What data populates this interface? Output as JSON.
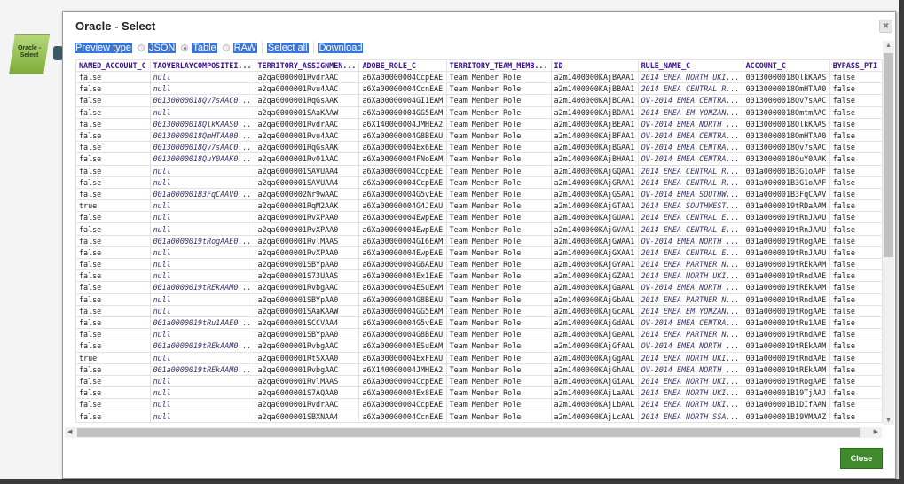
{
  "node": {
    "label": "Oracle - Select"
  },
  "dialog": {
    "title": "Oracle - Select",
    "toolbar": {
      "preview_type_label": "Preview type",
      "options": [
        {
          "label": "JSON",
          "selected": false
        },
        {
          "label": "Table",
          "selected": true
        },
        {
          "label": "RAW",
          "selected": false
        }
      ],
      "select_all_label": "Select all",
      "download_label": "Download"
    },
    "close_label": "Close",
    "accent_color": "#3f8a2a",
    "table": {
      "columns": [
        "NAMED_ACCOUNT_C",
        "TAOVERLAYCOMPOSITEI...",
        "TERRITORY_ASSIGNMEN...",
        "ADOBE_ROLE_C",
        "TERRITORY_TEAM_MEMB...",
        "ID",
        "RULE_NAME_C",
        "ACCOUNT_C",
        "BYPASS_PTI"
      ],
      "rows": [
        [
          "false",
          "null",
          "a2qa0000001RvdrAAC",
          "a6Xa00000004CcpEAE",
          "Team Member Role",
          "a2m1400000KAjBAAA1",
          "2014 EMEA NORTH UKI...",
          "00130000018QlkKAAS",
          "false"
        ],
        [
          "false",
          "null",
          "a2qa0000001Rvu4AAC",
          "a6Xa00000004CcnEAE",
          "Team Member Role",
          "a2m1400000KAjBBAA1",
          "2014 EMEA CENTRAL R...",
          "00130000018QmHTAA0",
          "false"
        ],
        [
          "false",
          "00130000018Qv7sAAC0...",
          "a2qa0000001RqGsAAK",
          "a6Xa00000004GI1EAM",
          "Team Member Role",
          "a2m1400000KAjBCAA1",
          "OV-2014 EMEA CENTRA...",
          "00130000018Qv7sAAC",
          "false"
        ],
        [
          "false",
          "null",
          "a2qa0000001SAaKAAW",
          "a6Xa00000004GG5EAM",
          "Team Member Role",
          "a2m1400000KAjBDAA1",
          "2014 EMEA EM YONZAN...",
          "00130000018QmtmAAC",
          "false"
        ],
        [
          "false",
          "00130000018QlkKAAS0...",
          "a2qa0000001RvdrAAC",
          "a6X140000004JMHEA2",
          "Team Member Role",
          "a2m1400000KAjBEAA1",
          "OV-2014 EMEA NORTH ...",
          "00130000018QlkKAAS",
          "false"
        ],
        [
          "false",
          "00130000018QmHTAA00...",
          "a2qa0000001Rvu4AAC",
          "a6Xa00000004G8BEAU",
          "Team Member Role",
          "a2m1400000KAjBFAA1",
          "OV-2014 EMEA CENTRA...",
          "00130000018QmHTAA0",
          "false"
        ],
        [
          "false",
          "00130000018Qv7sAAC0...",
          "a2qa0000001RqGsAAK",
          "a6Xa00000004Ex6EAE",
          "Team Member Role",
          "a2m1400000KAjBGAA1",
          "OV-2014 EMEA CENTRA...",
          "00130000018Qv7sAAC",
          "false"
        ],
        [
          "false",
          "00130000018QuY0AAK0...",
          "a2qa0000001Rv01AAC",
          "a6Xa00000004FNoEAM",
          "Team Member Role",
          "a2m1400000KAjBHAA1",
          "OV-2014 EMEA CENTRA...",
          "00130000018QuY0AAK",
          "false"
        ],
        [
          "false",
          "null",
          "a2qa0000001SAVUAA4",
          "a6Xa00000004CcpEAE",
          "Team Member Role",
          "a2m1400000KAjGQAA1",
          "2014 EMEA CENTRAL R...",
          "001a000001B3G1oAAF",
          "false"
        ],
        [
          "false",
          "null",
          "a2qa0000001SAVUAA4",
          "a6Xa00000004CcpEAE",
          "Team Member Role",
          "a2m1400000KAjGRAA1",
          "2014 EMEA CENTRAL R...",
          "001a000001B3G1oAAF",
          "false"
        ],
        [
          "false",
          "001a000001B3FqCAAV0...",
          "a2qa0000002Nr9wAAC",
          "a6Xa00000004G5vEAE",
          "Team Member Role",
          "a2m1400000KAjGSAA1",
          "OV-2014 EMEA SOUTHW...",
          "001a000001B3FqCAAV",
          "false"
        ],
        [
          "true",
          "null",
          "a2qa0000001RqM2AAK",
          "a6Xa00000004G4JEAU",
          "Team Member Role",
          "a2m1400000KAjGTAA1",
          "2014 EMEA SOUTHWEST...",
          "001a0000019tRDaAAM",
          "false"
        ],
        [
          "false",
          "null",
          "a2qa0000001RvXPAA0",
          "a6Xa00000004EwpEAE",
          "Team Member Role",
          "a2m1400000KAjGUAA1",
          "2014 EMEA CENTRAL E...",
          "001a0000019tRnJAAU",
          "false"
        ],
        [
          "false",
          "null",
          "a2qa0000001RvXPAA0",
          "a6Xa00000004EwpEAE",
          "Team Member Role",
          "a2m1400000KAjGVAA1",
          "2014 EMEA CENTRAL E...",
          "001a0000019tRnJAAU",
          "false"
        ],
        [
          "false",
          "001a0000019tRogAAE0...",
          "a2qa0000001RvlMAAS",
          "a6Xa00000004GI6EAM",
          "Team Member Role",
          "a2m1400000KAjGWAA1",
          "OV-2014 EMEA NORTH ...",
          "001a0000019tRogAAE",
          "false"
        ],
        [
          "false",
          "null",
          "a2qa0000001RvXPAA0",
          "a6Xa00000004EwpEAE",
          "Team Member Role",
          "a2m1400000KAjGXAA1",
          "2014 EMEA CENTRAL E...",
          "001a0000019tRnJAAU",
          "false"
        ],
        [
          "false",
          "null",
          "a2qa0000001SBYpAA0",
          "a6Xa00000004G6AEAU",
          "Team Member Role",
          "a2m1400000KAjGYAA1",
          "2014 EMEA PARTNER N...",
          "001a0000019tREkAAM",
          "false"
        ],
        [
          "false",
          "null",
          "a2qa0000001S73UAAS",
          "a6Xa00000004Ex1EAE",
          "Team Member Role",
          "a2m1400000KAjGZAA1",
          "2014 EMEA NORTH UKI...",
          "001a0000019tRndAAE",
          "false"
        ],
        [
          "false",
          "001a0000019tREkAAM0...",
          "a2qa0000001RvbgAAC",
          "a6Xa00000004ESuEAM",
          "Team Member Role",
          "a2m1400000KAjGaAAL",
          "OV-2014 EMEA NORTH ...",
          "001a0000019tREkAAM",
          "false"
        ],
        [
          "false",
          "null",
          "a2qa0000001SBYpAA0",
          "a6Xa00000004G8BEAU",
          "Team Member Role",
          "a2m1400000KAjGbAAL",
          "2014 EMEA PARTNER N...",
          "001a0000019tRndAAE",
          "false"
        ],
        [
          "false",
          "null",
          "a2qa0000001SAaKAAW",
          "a6Xa00000004GG5EAM",
          "Team Member Role",
          "a2m1400000KAjGcAAL",
          "2014 EMEA EM YONZAN...",
          "001a0000019tRogAAE",
          "false"
        ],
        [
          "false",
          "001a0000019tRu1AAE0...",
          "a2qa0000001SCCVAA4",
          "a6Xa00000004G5vEAE",
          "Team Member Role",
          "a2m1400000KAjGdAAL",
          "OV-2014 EMEA CENTRA...",
          "001a0000019tRu1AAE",
          "false"
        ],
        [
          "false",
          "null",
          "a2qa0000001SBYpAA0",
          "a6Xa00000004G8BEAU",
          "Team Member Role",
          "a2m1400000KAjGeAAL",
          "2014 EMEA PARTNER N...",
          "001a0000019tRndAAE",
          "false"
        ],
        [
          "false",
          "001a0000019tREkAAM0...",
          "a2qa0000001RvbgAAC",
          "a6Xa00000004ESuEAM",
          "Team Member Role",
          "a2m1400000KAjGfAAL",
          "OV-2014 EMEA NORTH ...",
          "001a0000019tREkAAM",
          "false"
        ],
        [
          "true",
          "null",
          "a2qa0000001RtSXAA0",
          "a6Xa00000004ExFEAU",
          "Team Member Role",
          "a2m1400000KAjGgAAL",
          "2014 EMEA NORTH UKI...",
          "001a0000019tRndAAE",
          "false"
        ],
        [
          "false",
          "001a0000019tREkAAM0...",
          "a2qa0000001RvbgAAC",
          "a6X140000004JMHEA2",
          "Team Member Role",
          "a2m1400000KAjGhAAL",
          "OV-2014 EMEA NORTH ...",
          "001a0000019tREkAAM",
          "false"
        ],
        [
          "false",
          "null",
          "a2qa0000001RvlMAAS",
          "a6Xa00000004CcpEAE",
          "Team Member Role",
          "a2m1400000KAjGiAAL",
          "2014 EMEA NORTH UKI...",
          "001a0000019tRogAAE",
          "false"
        ],
        [
          "false",
          "null",
          "a2qa0000001S7AQAA0",
          "a6Xa00000004Ex8EAE",
          "Team Member Role",
          "a2m1400000KAjLaAAL",
          "2014 EMEA NORTH UKI...",
          "001a000001B19TjAAJ",
          "false"
        ],
        [
          "false",
          "null",
          "a2qa0000001RvdrAAC",
          "a6Xa00000004CcpEAE",
          "Team Member Role",
          "a2m1400000KAjLbAAL",
          "2014 EMEA NORTH UKI...",
          "001a000001B1DIfAAN",
          "false"
        ],
        [
          "false",
          "null",
          "a2qa0000001SBXNAA4",
          "a6Xa00000004CcnEAE",
          "Team Member Role",
          "a2m1400000KAjLcAAL",
          "2014 EMEA NORTH SSA...",
          "001a000001B19VMAAZ",
          "false"
        ]
      ]
    }
  }
}
